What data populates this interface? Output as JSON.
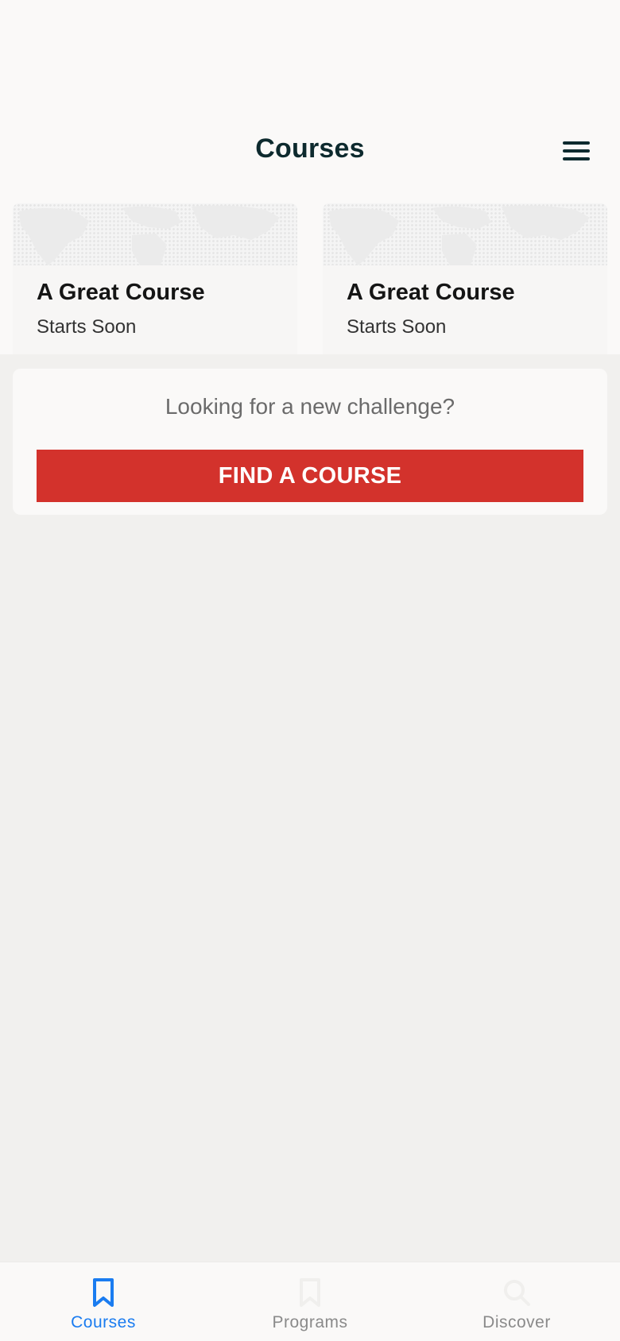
{
  "header": {
    "title": "Courses",
    "menu_icon": "hamburger-menu-icon"
  },
  "courses": [
    {
      "title": "A Great Course",
      "subtitle": "Starts Soon"
    },
    {
      "title": "A Great Course",
      "subtitle": "Starts Soon"
    }
  ],
  "challenge": {
    "prompt": "Looking for a new challenge?",
    "button_label": "FIND A COURSE"
  },
  "tab_bar": {
    "tabs": [
      {
        "label": "Courses",
        "icon": "bookmark-icon",
        "active": true
      },
      {
        "label": "Programs",
        "icon": "bookmark-icon",
        "active": false
      },
      {
        "label": "Discover",
        "icon": "search-icon",
        "active": false
      }
    ]
  },
  "colors": {
    "accent": "#1a7cf0",
    "brand_red": "#d3322c",
    "title_dark": "#0d2a2e",
    "inactive_tab": "#8a8a8a"
  }
}
